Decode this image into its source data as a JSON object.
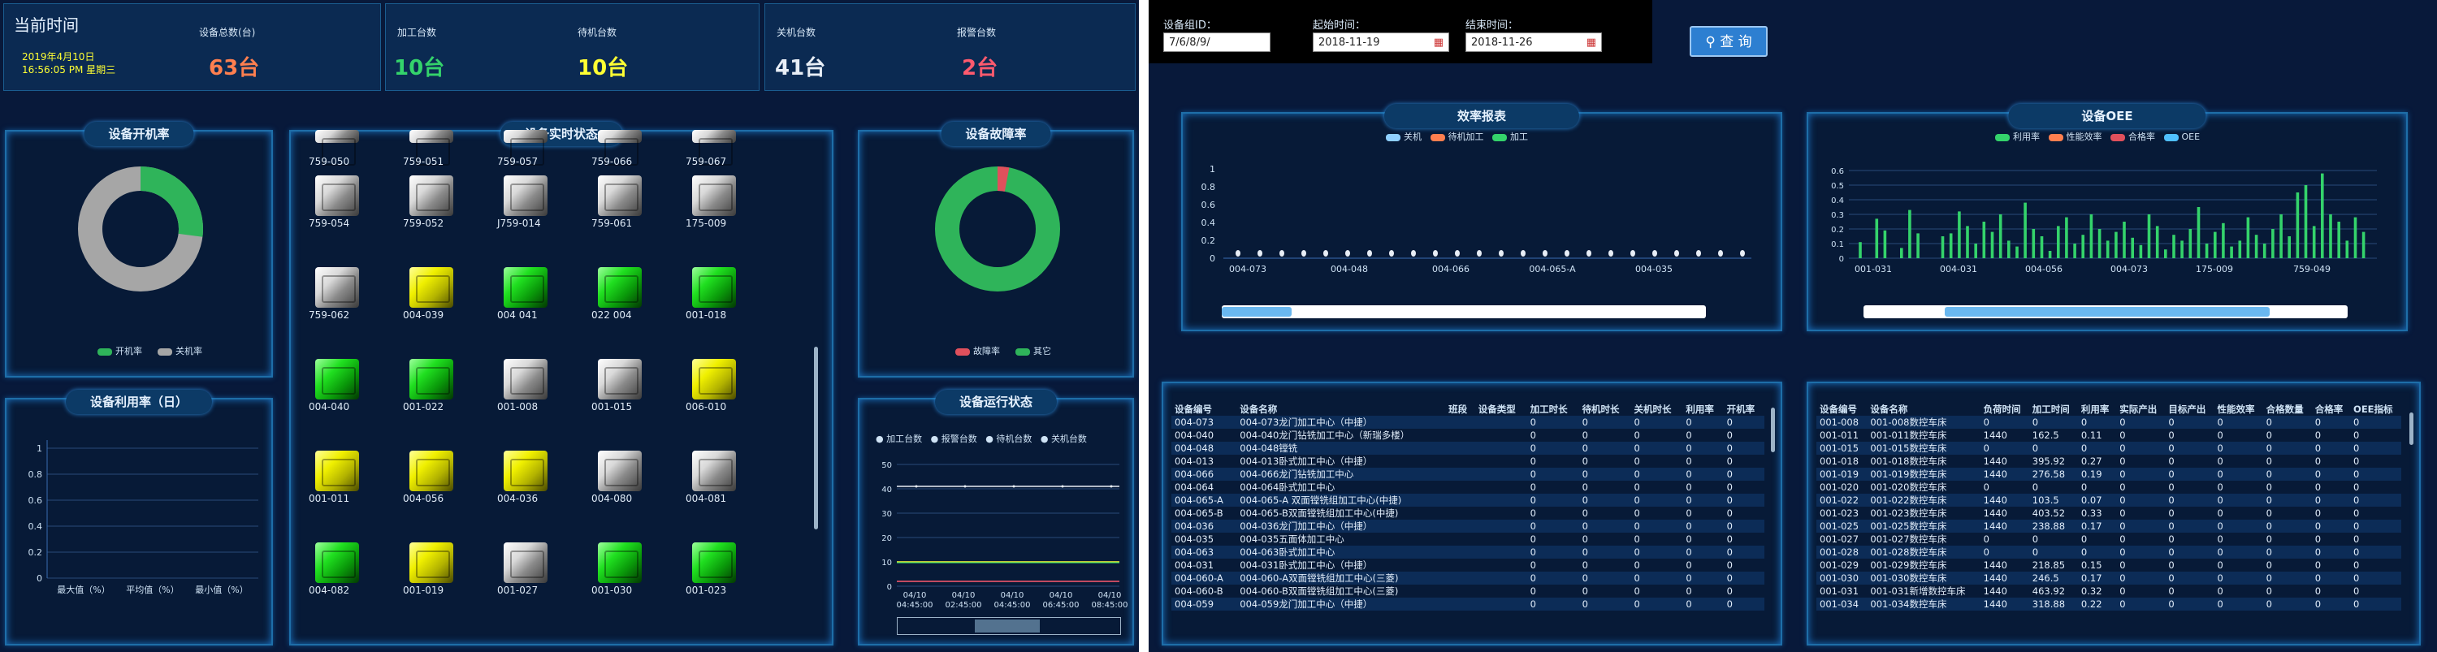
{
  "left": {
    "clock": {
      "title": "当前时间",
      "date": "2019年4月10日",
      "time_weekday": "16:56:05 PM 星期三"
    },
    "kpis": [
      {
        "label": "设备总数(台)",
        "value": "63台",
        "color": "#ff7f4f"
      },
      {
        "label": "加工台数",
        "value": "10台",
        "color": "#34d36b"
      },
      {
        "label": "待机台数",
        "value": "10台",
        "color": "#ffff33"
      },
      {
        "label": "关机台数",
        "value": "41台",
        "color": "#e8eef6"
      },
      {
        "label": "报警台数",
        "value": "2台",
        "color": "#ff5a6e"
      }
    ],
    "startup_rate": {
      "title": "设备开机率",
      "legend": [
        {
          "label": "开机率",
          "color": "#2fb45a"
        },
        {
          "label": "关机率",
          "color": "#a6a6a6"
        }
      ],
      "values": [
        0.27,
        0.73
      ]
    },
    "utilization": {
      "title": "设备利用率（日）",
      "yticks": [
        "0",
        "0.2",
        "0.4",
        "0.6",
        "0.8",
        "1"
      ],
      "categories": [
        "最大值（%）",
        "平均值（%）",
        "最小值（%）"
      ]
    },
    "realtime": {
      "title": "设备实时状态",
      "top_row": [
        "759-050",
        "759-051",
        "759-057",
        "759-066",
        "759-067"
      ],
      "tiles": [
        [
          {
            "id": "759-054",
            "c": "white"
          },
          {
            "id": "759-052",
            "c": "white"
          },
          {
            "id": "J759-014",
            "c": "white"
          },
          {
            "id": "759-061",
            "c": "white"
          },
          {
            "id": "175-009",
            "c": "white"
          }
        ],
        [
          {
            "id": "759-062",
            "c": "white"
          },
          {
            "id": "004-039",
            "c": "yellow"
          },
          {
            "id": "004 041",
            "c": "green"
          },
          {
            "id": "022 004",
            "c": "green"
          },
          {
            "id": "001-018",
            "c": "green"
          }
        ],
        [
          {
            "id": "004-040",
            "c": "green"
          },
          {
            "id": "001-022",
            "c": "green"
          },
          {
            "id": "001-008",
            "c": "white"
          },
          {
            "id": "001-015",
            "c": "white"
          },
          {
            "id": "006-010",
            "c": "yellow"
          }
        ],
        [
          {
            "id": "001-011",
            "c": "yellow"
          },
          {
            "id": "004-056",
            "c": "yellow"
          },
          {
            "id": "004-036",
            "c": "yellow"
          },
          {
            "id": "004-080",
            "c": "white"
          },
          {
            "id": "004-081",
            "c": "white"
          }
        ],
        [
          {
            "id": "004-082",
            "c": "green"
          },
          {
            "id": "001-019",
            "c": "yellow"
          },
          {
            "id": "001-027",
            "c": "white"
          },
          {
            "id": "001-030",
            "c": "green"
          },
          {
            "id": "001-023",
            "c": "green"
          }
        ]
      ]
    },
    "fault_rate": {
      "title": "设备故障率",
      "legend": [
        {
          "label": "故障率",
          "color": "#e0505c"
        },
        {
          "label": "其它",
          "color": "#2fb45a"
        }
      ],
      "values": [
        0.03,
        0.97
      ]
    },
    "run_status": {
      "title": "设备运行状态",
      "legend": [
        {
          "label": "加工台数",
          "color": "#ffffff"
        },
        {
          "label": "报警台数",
          "color": "#ffffff"
        },
        {
          "label": "待机台数",
          "color": "#ffffff"
        },
        {
          "label": "关机台数",
          "color": "#ffffff"
        }
      ],
      "yticks": [
        "0",
        "10",
        "20",
        "30",
        "40",
        "50"
      ],
      "xticks": [
        [
          "04/10",
          "04:45:00"
        ],
        [
          "04/10",
          "02:45:00"
        ],
        [
          "04/10",
          "04:45:00"
        ],
        [
          "04/10",
          "06:45:00"
        ],
        [
          "04/10",
          "08:45:00"
        ]
      ]
    }
  },
  "right": {
    "filters": {
      "device_label": "设备组ID：",
      "device_value": "7/6/8/9/",
      "start_label": "起始时间：",
      "start_value": "2018-11-19",
      "end_label": "结束时间：",
      "end_value": "2018-11-26",
      "query_label": "查 询"
    },
    "efficiency": {
      "title": "效率报表",
      "legend": [
        {
          "label": "关机",
          "color": "#8fd0ff"
        },
        {
          "label": "待机加工",
          "color": "#ff7f4f"
        },
        {
          "label": "加工",
          "color": "#34d36b"
        }
      ],
      "yticks": [
        "0",
        "0.2",
        "0.4",
        "0.6",
        "0.8",
        "1"
      ],
      "xticks": [
        "004-073",
        "004-048",
        "004-066",
        "004-065-A",
        "004-035"
      ]
    },
    "oee": {
      "title": "设备OEE",
      "legend": [
        {
          "label": "利用率",
          "color": "#34d36b"
        },
        {
          "label": "性能效率",
          "color": "#ff7f4f"
        },
        {
          "label": "合格率",
          "color": "#e0505c"
        },
        {
          "label": "OEE",
          "color": "#4fc0ff"
        }
      ],
      "yticks": [
        "0",
        "0.1",
        "0.2",
        "0.3",
        "0.4",
        "0.5",
        "0.6"
      ],
      "xticks": [
        "001-031",
        "004-031",
        "004-056",
        "004-073",
        "175-009",
        "759-049"
      ]
    },
    "table1": {
      "headers": [
        "设备编号",
        "设备名称",
        "班段",
        "设备类型",
        "加工时长",
        "待机时长",
        "关机时长",
        "利用率",
        "开机率"
      ],
      "rows": [
        [
          "004-073",
          "004-073龙门加工中心（中捷）",
          "",
          "",
          "0",
          "0",
          "0",
          "0",
          "0"
        ],
        [
          "004-040",
          "004-040龙门钻铣加工中心（新瑞多楼）",
          "",
          "",
          "0",
          "0",
          "0",
          "0",
          "0"
        ],
        [
          "004-048",
          "004-048镗铣",
          "",
          "",
          "0",
          "0",
          "0",
          "0",
          "0"
        ],
        [
          "004-013",
          "004-013卧式加工中心（中捷）",
          "",
          "",
          "0",
          "0",
          "0",
          "0",
          "0"
        ],
        [
          "004-066",
          "004-066龙门钻铣加工中心",
          "",
          "",
          "0",
          "0",
          "0",
          "0",
          "0"
        ],
        [
          "004-064",
          "004-064卧式加工中心",
          "",
          "",
          "0",
          "0",
          "0",
          "0",
          "0"
        ],
        [
          "004-065-A",
          "004-065-A 双面镗铣组加工中心(中捷)",
          "",
          "",
          "0",
          "0",
          "0",
          "0",
          "0"
        ],
        [
          "004-065-B",
          "004-065-B双面镗铣组加工中心(中捷)",
          "",
          "",
          "0",
          "0",
          "0",
          "0",
          "0"
        ],
        [
          "004-036",
          "004-036龙门加工中心（中捷）",
          "",
          "",
          "0",
          "0",
          "0",
          "0",
          "0"
        ],
        [
          "004-035",
          "004-035五面体加工中心",
          "",
          "",
          "0",
          "0",
          "0",
          "0",
          "0"
        ],
        [
          "004-063",
          "004-063卧式加工中心",
          "",
          "",
          "0",
          "0",
          "0",
          "0",
          "0"
        ],
        [
          "004-031",
          "004-031卧式加工中心（中捷）",
          "",
          "",
          "0",
          "0",
          "0",
          "0",
          "0"
        ],
        [
          "004-060-A",
          "004-060-A双面镗铣组加工中心(三菱)",
          "",
          "",
          "0",
          "0",
          "0",
          "0",
          "0"
        ],
        [
          "004-060-B",
          "004-060-B双面镗铣组加工中心(三菱)",
          "",
          "",
          "0",
          "0",
          "0",
          "0",
          "0"
        ],
        [
          "004-059",
          "004-059龙门加工中心（中捷）",
          "",
          "",
          "0",
          "0",
          "0",
          "0",
          "0"
        ]
      ]
    },
    "table2": {
      "headers": [
        "设备编号",
        "设备名称",
        "负荷时间",
        "加工时间",
        "利用率",
        "实际产出",
        "目标产出",
        "性能效率",
        "合格数量",
        "合格率",
        "OEE指标"
      ],
      "rows": [
        [
          "001-008",
          "001-008数控车床",
          "0",
          "0",
          "0",
          "0",
          "0",
          "0",
          "0",
          "0",
          "0"
        ],
        [
          "001-011",
          "001-011数控车床",
          "1440",
          "162.5",
          "0.11",
          "0",
          "0",
          "0",
          "0",
          "0",
          "0"
        ],
        [
          "001-015",
          "001-015数控车床",
          "0",
          "0",
          "0",
          "0",
          "0",
          "0",
          "0",
          "0",
          "0"
        ],
        [
          "001-018",
          "001-018数控车床",
          "1440",
          "395.92",
          "0.27",
          "0",
          "0",
          "0",
          "0",
          "0",
          "0"
        ],
        [
          "001-019",
          "001-019数控车床",
          "1440",
          "276.58",
          "0.19",
          "0",
          "0",
          "0",
          "0",
          "0",
          "0"
        ],
        [
          "001-020",
          "001-020数控车床",
          "0",
          "0",
          "0",
          "0",
          "0",
          "0",
          "0",
          "0",
          "0"
        ],
        [
          "001-022",
          "001-022数控车床",
          "1440",
          "103.5",
          "0.07",
          "0",
          "0",
          "0",
          "0",
          "0",
          "0"
        ],
        [
          "001-023",
          "001-023数控车床",
          "1440",
          "403.52",
          "0.33",
          "0",
          "0",
          "0",
          "0",
          "0",
          "0"
        ],
        [
          "001-025",
          "001-025数控车床",
          "1440",
          "238.88",
          "0.17",
          "0",
          "0",
          "0",
          "0",
          "0",
          "0"
        ],
        [
          "001-027",
          "001-027数控车床",
          "0",
          "0",
          "0",
          "0",
          "0",
          "0",
          "0",
          "0",
          "0"
        ],
        [
          "001-028",
          "001-028数控车床",
          "0",
          "0",
          "0",
          "0",
          "0",
          "0",
          "0",
          "0",
          "0"
        ],
        [
          "001-029",
          "001-029数控车床",
          "1440",
          "218.85",
          "0.15",
          "0",
          "0",
          "0",
          "0",
          "0",
          "0"
        ],
        [
          "001-030",
          "001-030数控车床",
          "1440",
          "246.5",
          "0.17",
          "0",
          "0",
          "0",
          "0",
          "0",
          "0"
        ],
        [
          "001-031",
          "001-031新增数控车床",
          "1440",
          "463.92",
          "0.32",
          "0",
          "0",
          "0",
          "0",
          "0",
          "0"
        ],
        [
          "001-034",
          "001-034数控车床",
          "1440",
          "318.88",
          "0.22",
          "0",
          "0",
          "0",
          "0",
          "0",
          "0"
        ]
      ]
    }
  }
}
